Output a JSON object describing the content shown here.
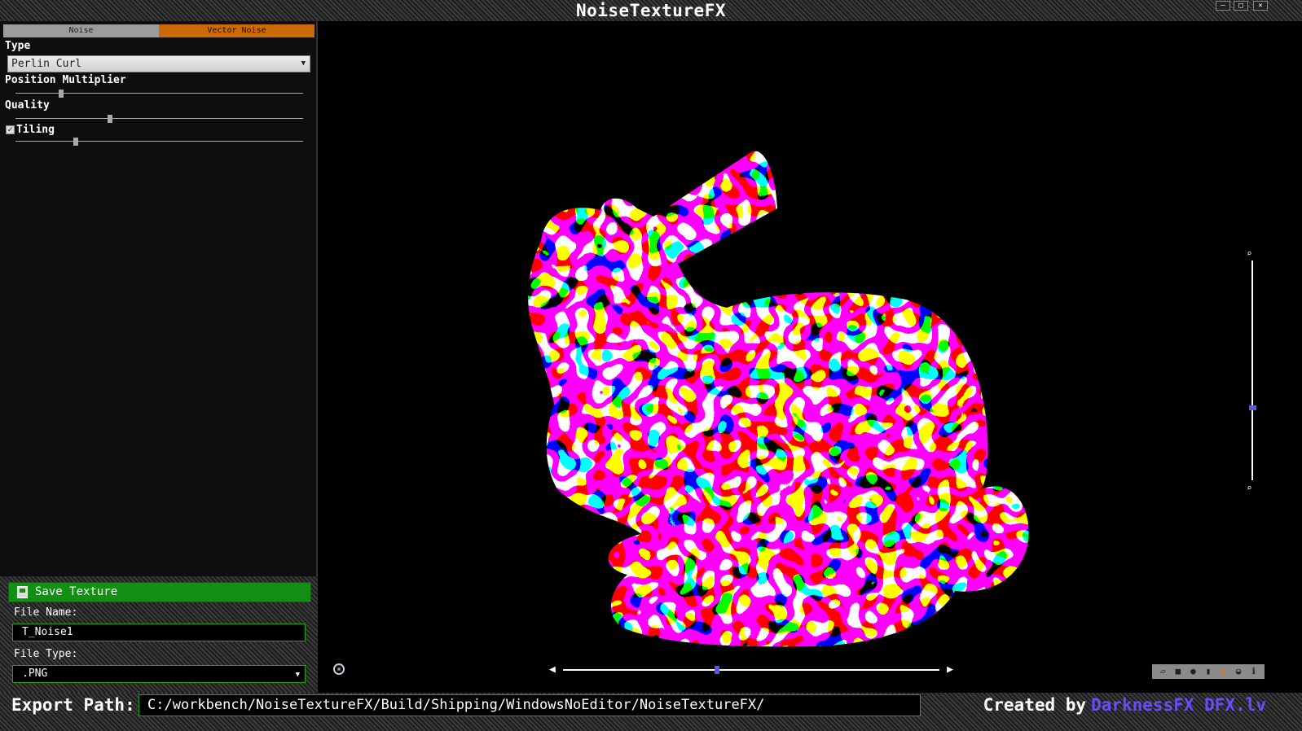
{
  "window": {
    "title": "NoiseTextureFX",
    "minimize_glyph": "–",
    "maximize_glyph": "□",
    "close_glyph": "✕"
  },
  "tabs": [
    {
      "label": "Noise",
      "active": false
    },
    {
      "label": "Vector Noise",
      "active": true
    }
  ],
  "noise_settings": {
    "type_label": "Type",
    "type_value": "Perlin Curl",
    "position_multiplier_label": "Position Multiplier",
    "position_multiplier_level": 0.16,
    "quality_label": "Quality",
    "quality_level": 0.33,
    "tiling_label": "Tiling",
    "tiling_checked": true,
    "tiling_level": 0.21
  },
  "save": {
    "button_label": "Save Texture",
    "file_name_label": "File Name:",
    "file_name_value": "T_Noise1",
    "file_type_label": "File Type:",
    "file_type_value": ".PNG"
  },
  "bottom_bar": {
    "export_label": "Export Path:",
    "export_path": "C:/workbench/NoiseTextureFX/Build/Shipping/WindowsNoEditor/NoiseTextureFX/",
    "created_by": "Created by",
    "brand": "DarknessFX DFX.lv"
  },
  "viewport": {
    "rotation_level": 0.41,
    "zoom_level": 0.67,
    "mesh_options": [
      "plane-icon",
      "cube-icon",
      "sphere-icon",
      "cylinder-icon",
      "bunny-icon",
      "teapot-icon",
      "info-icon"
    ],
    "active_mesh": "bunny-icon"
  },
  "colors": {
    "accent_orange": "#cc6a05",
    "save_green": "#138f13",
    "field_border_green": "#1aa51a",
    "slider_thumb_blue": "#5a5ad6",
    "brand_blue": "#6a4cff"
  }
}
